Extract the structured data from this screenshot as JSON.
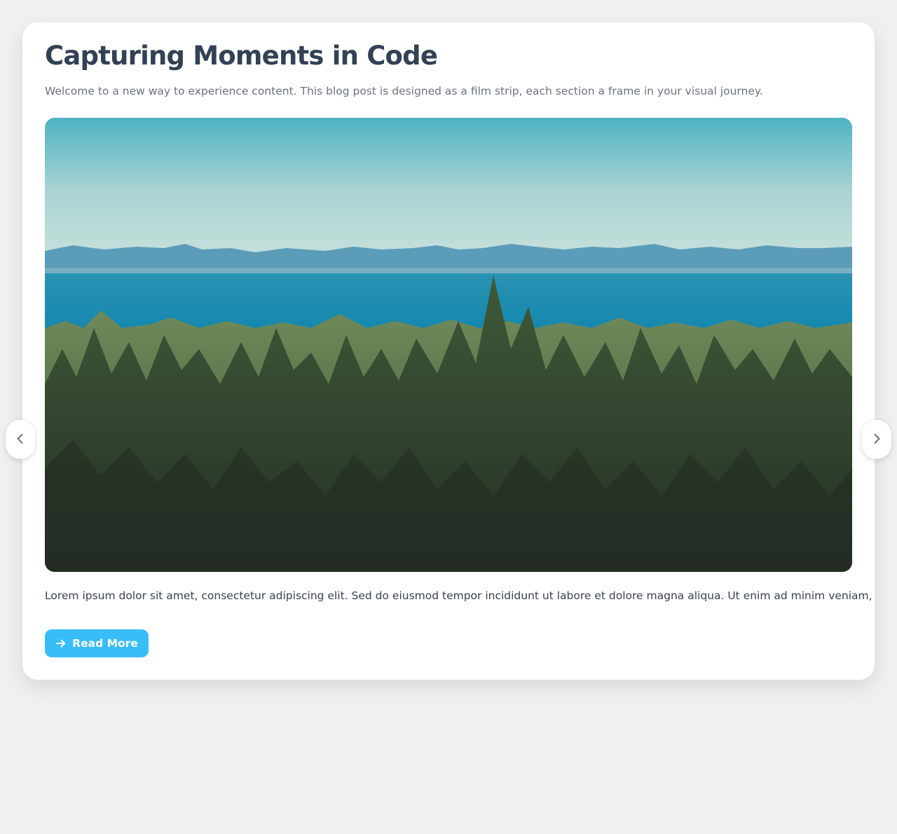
{
  "post": {
    "title": "Capturing Moments in Code",
    "intro": "Welcome to a new way to experience content. This blog post is designed as a film strip, each section a frame in your visual journey.",
    "body": "Lorem ipsum dolor sit amet, consectetur adipiscing elit. Sed do eiusmod tempor incididunt ut labore et dolore magna aliqua. Ut enim ad minim veniam, quis nostrud exercitation ullamco laboris nisi ut aliquip ex ea commodo consequat.",
    "read_more_label": "Read More"
  },
  "icons": {
    "read_more": "arrow-right-icon",
    "prev": "chevron-left-icon",
    "next": "chevron-right-icon"
  },
  "colors": {
    "page_background": "#f0f0f0",
    "card_background": "#ffffff",
    "title": "#334155",
    "intro": "#6b7280",
    "body": "#374151",
    "accent": "#38bdf8"
  }
}
